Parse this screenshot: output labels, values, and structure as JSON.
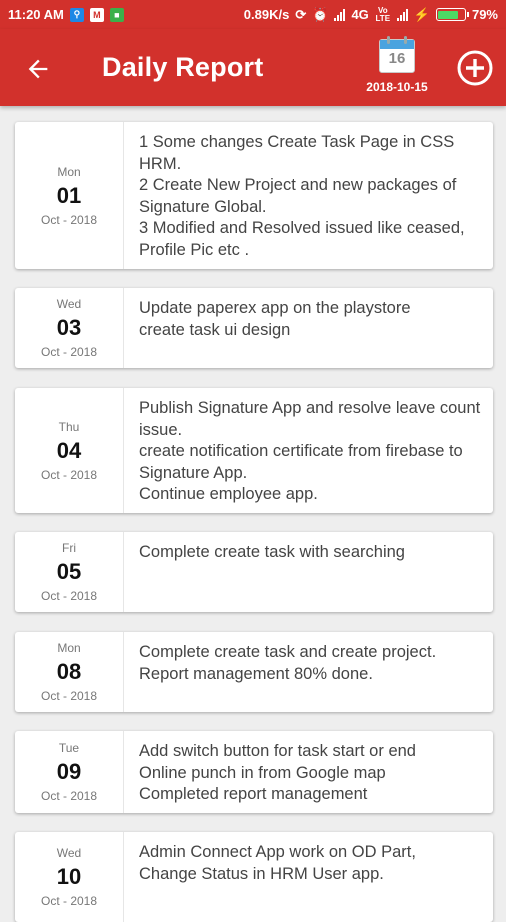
{
  "status_bar": {
    "time": "11:20 AM",
    "speed": "0.89K/s",
    "network": "4G",
    "volte": "Vo LTE",
    "battery": "79%",
    "battery_level": 0.79
  },
  "app_bar": {
    "title": "Daily Report",
    "calendar_day": "16",
    "calendar_date": "2018-10-15"
  },
  "reports": [
    {
      "dow": "Mon",
      "day": "01",
      "month_year": "Oct - 2018",
      "text": "1  Some changes Create Task Page in CSS HRM.\n2 Create New Project and new packages of Signature Global.\n3 Modified and Resolved issued like ceased, Profile Pic etc ."
    },
    {
      "dow": "Wed",
      "day": "03",
      "month_year": "Oct - 2018",
      "text": "Update paperex app on the playstore\ncreate task ui  design"
    },
    {
      "dow": "Thu",
      "day": "04",
      "month_year": "Oct - 2018",
      "text": "Publish Signature App and resolve leave count issue.\ncreate notification certificate from firebase to Signature App.\nContinue employee  app."
    },
    {
      "dow": "Fri",
      "day": "05",
      "month_year": "Oct - 2018",
      "text": "Complete create task  with searching"
    },
    {
      "dow": "Mon",
      "day": "08",
      "month_year": "Oct - 2018",
      "text": "Complete create task and create project.\nReport management 80% done."
    },
    {
      "dow": "Tue",
      "day": "09",
      "month_year": "Oct - 2018",
      "text": "Add switch button for task start or end\nOnline punch in from Google map\nCompleted report management"
    },
    {
      "dow": "Wed",
      "day": "10",
      "month_year": "Oct - 2018",
      "text": "Admin Connect App work on OD Part,\nChange Status in HRM User app."
    }
  ]
}
